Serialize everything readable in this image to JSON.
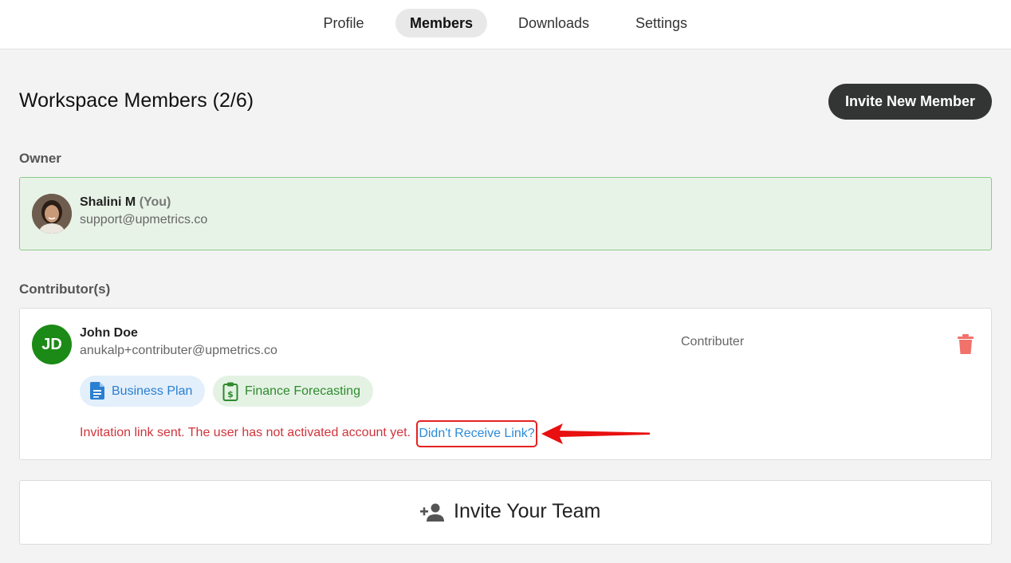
{
  "nav": {
    "tabs": [
      {
        "label": "Profile",
        "active": false
      },
      {
        "label": "Members",
        "active": true
      },
      {
        "label": "Downloads",
        "active": false
      },
      {
        "label": "Settings",
        "active": false
      }
    ]
  },
  "page": {
    "title": "Workspace Members (2/6)",
    "invite_button": "Invite New Member"
  },
  "owner_section": {
    "label": "Owner",
    "member": {
      "name": "Shalini M",
      "you_tag": "(You)",
      "email": "support@upmetrics.co",
      "avatar_icon": "profile-photo"
    }
  },
  "contributors_section": {
    "label": "Contributor(s)",
    "members": [
      {
        "initials": "JD",
        "name": "John Doe",
        "email": "anukalp+contributer@upmetrics.co",
        "role": "Contributer",
        "delete_icon": "trash-icon",
        "access": [
          {
            "label": "Business Plan",
            "icon": "document-icon"
          },
          {
            "label": "Finance Forecasting",
            "icon": "clipboard-dollar-icon"
          }
        ],
        "status_message": "Invitation link sent. The user has not activated account yet.",
        "resend_link": "Didn't Receive Link?"
      }
    ]
  },
  "invite_team": {
    "label": "Invite Your Team",
    "icon": "add-person-icon"
  },
  "colors": {
    "accent_dark": "#333534",
    "owner_bg": "#e8f3e7",
    "owner_border": "#8ecb8a",
    "error_red": "#d1343c",
    "link_blue": "#2a8bd8",
    "avatar_green": "#1b8a16",
    "trash_red": "#f0726a"
  }
}
